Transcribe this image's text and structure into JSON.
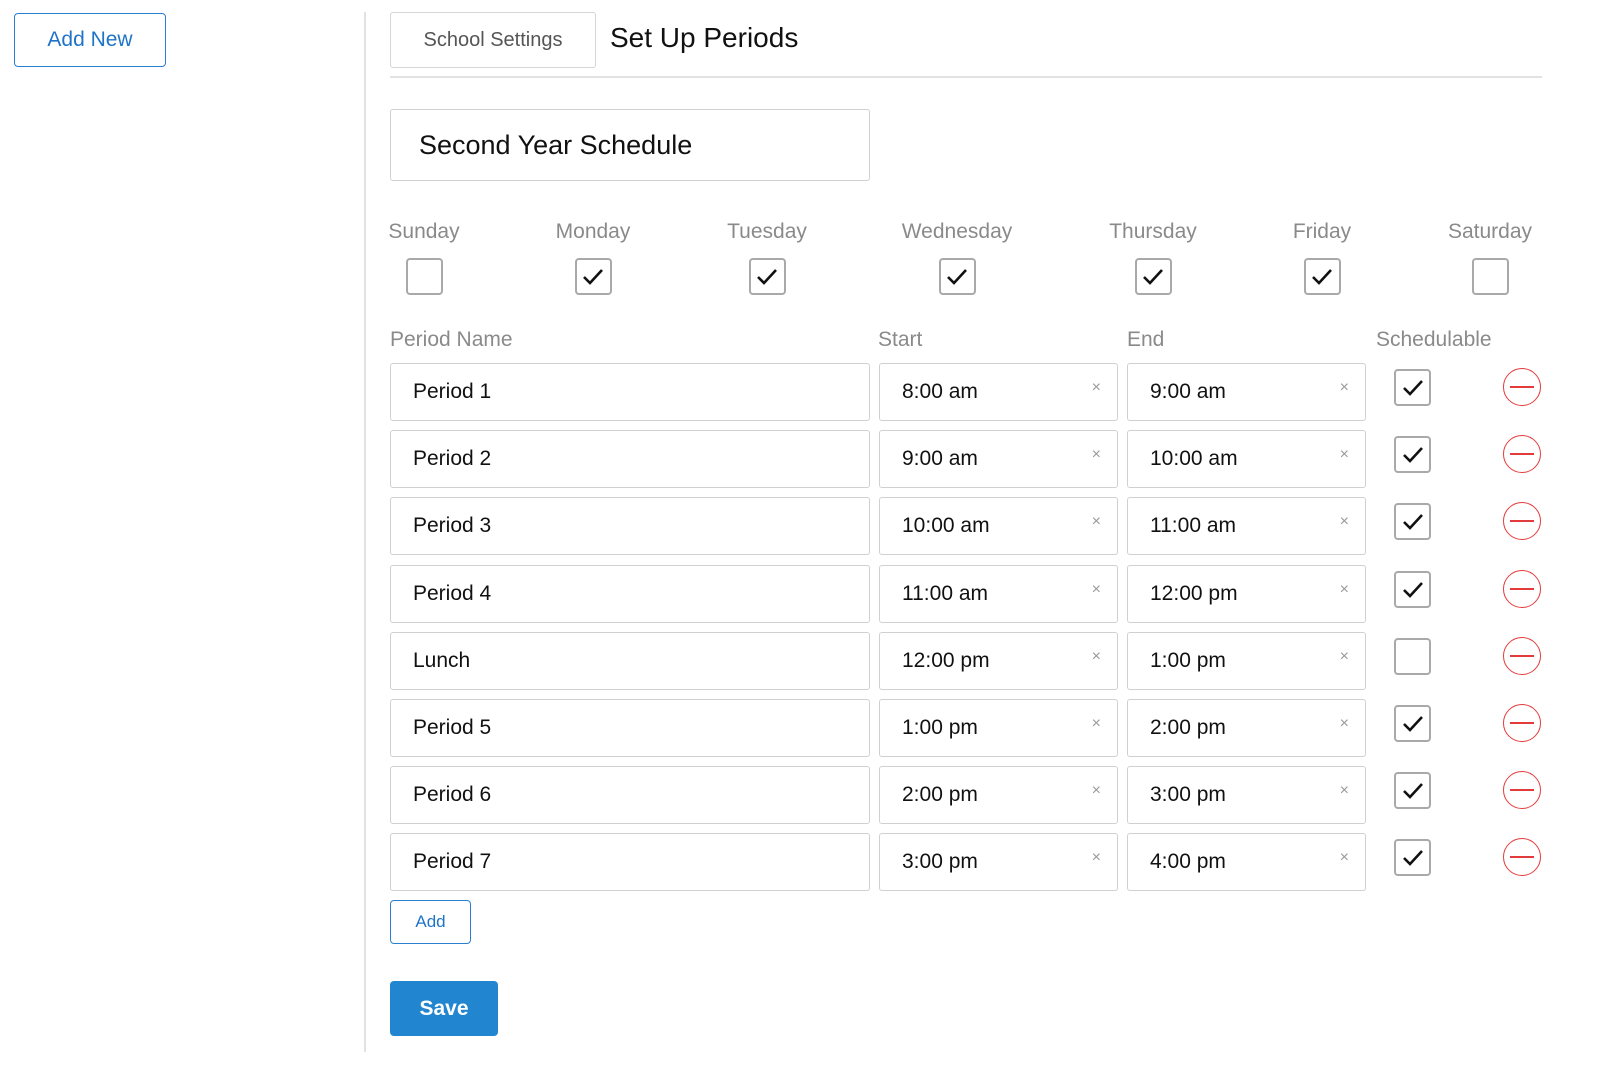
{
  "sidebar": {
    "add_new_label": "Add New"
  },
  "header": {
    "school_settings_label": "School Settings",
    "page_title": "Set Up Periods"
  },
  "schedule": {
    "name": "Second Year Schedule"
  },
  "days": [
    {
      "label": "Sunday",
      "checked": false
    },
    {
      "label": "Monday",
      "checked": true
    },
    {
      "label": "Tuesday",
      "checked": true
    },
    {
      "label": "Wednesday",
      "checked": true
    },
    {
      "label": "Thursday",
      "checked": true
    },
    {
      "label": "Friday",
      "checked": true
    },
    {
      "label": "Saturday",
      "checked": false
    }
  ],
  "columns": {
    "name": "Period Name",
    "start": "Start",
    "end": "End",
    "schedulable": "Schedulable"
  },
  "periods": [
    {
      "name": "Period 1",
      "start": "8:00 am",
      "end": "9:00 am",
      "schedulable": true
    },
    {
      "name": "Period 2",
      "start": "9:00 am",
      "end": "10:00 am",
      "schedulable": true
    },
    {
      "name": "Period 3",
      "start": "10:00 am",
      "end": "11:00 am",
      "schedulable": true
    },
    {
      "name": "Period 4",
      "start": "11:00 am",
      "end": "12:00 pm",
      "schedulable": true
    },
    {
      "name": "Lunch",
      "start": "12:00 pm",
      "end": "1:00 pm",
      "schedulable": false
    },
    {
      "name": "Period 5",
      "start": "1:00 pm",
      "end": "2:00 pm",
      "schedulable": true
    },
    {
      "name": "Period 6",
      "start": "2:00 pm",
      "end": "3:00 pm",
      "schedulable": true
    },
    {
      "name": "Period 7",
      "start": "3:00 pm",
      "end": "4:00 pm",
      "schedulable": true
    }
  ],
  "clear_glyph": "×",
  "actions": {
    "add_label": "Add",
    "save_label": "Save"
  },
  "colors": {
    "accent": "#2185d0",
    "danger": "#e33b3b"
  }
}
